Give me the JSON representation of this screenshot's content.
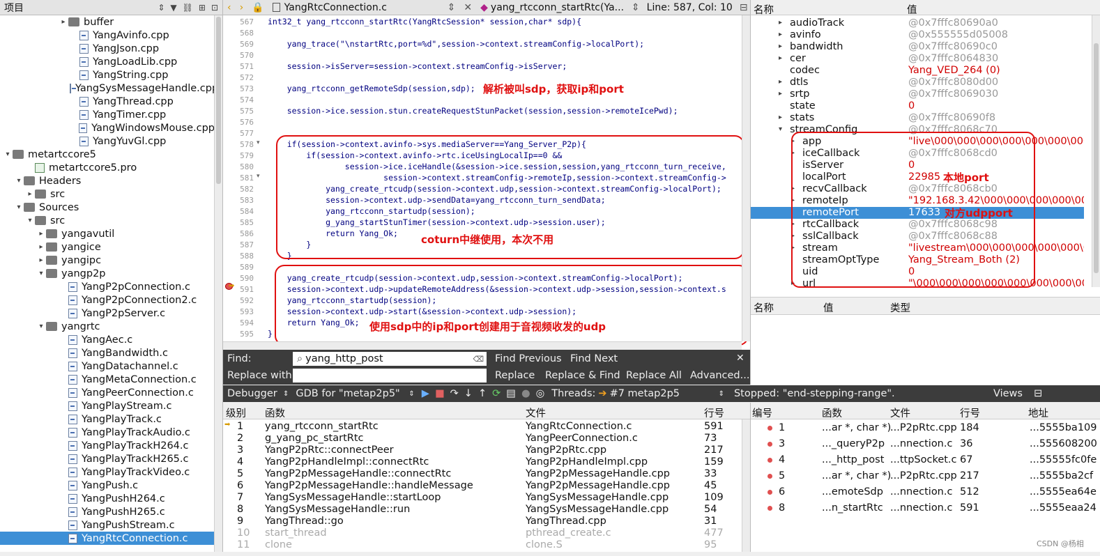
{
  "left": {
    "header": "项目",
    "tree": [
      {
        "label": "buffer",
        "indent": 5,
        "kind": "dir",
        "arrow": "▸"
      },
      {
        "label": "YangAvinfo.cpp",
        "indent": 6,
        "kind": "file"
      },
      {
        "label": "YangJson.cpp",
        "indent": 6,
        "kind": "file"
      },
      {
        "label": "YangLoadLib.cpp",
        "indent": 6,
        "kind": "file"
      },
      {
        "label": "YangString.cpp",
        "indent": 6,
        "kind": "file"
      },
      {
        "label": "YangSysMessageHandle.cpp",
        "indent": 6,
        "kind": "file"
      },
      {
        "label": "YangThread.cpp",
        "indent": 6,
        "kind": "file"
      },
      {
        "label": "YangTimer.cpp",
        "indent": 6,
        "kind": "file"
      },
      {
        "label": "YangWindowsMouse.cpp",
        "indent": 6,
        "kind": "file"
      },
      {
        "label": "YangYuvGl.cpp",
        "indent": 6,
        "kind": "file"
      },
      {
        "label": "metartccore5",
        "indent": 0,
        "kind": "proj",
        "arrow": "▾"
      },
      {
        "label": "metartccore5.pro",
        "indent": 2,
        "kind": "pro"
      },
      {
        "label": "Headers",
        "indent": 1,
        "kind": "dir",
        "arrow": "▾"
      },
      {
        "label": "src",
        "indent": 2,
        "kind": "dir",
        "arrow": "▸"
      },
      {
        "label": "Sources",
        "indent": 1,
        "kind": "dir",
        "arrow": "▾"
      },
      {
        "label": "src",
        "indent": 2,
        "kind": "dir",
        "arrow": "▾"
      },
      {
        "label": "yangavutil",
        "indent": 3,
        "kind": "dir",
        "arrow": "▸"
      },
      {
        "label": "yangice",
        "indent": 3,
        "kind": "dir",
        "arrow": "▸"
      },
      {
        "label": "yangipc",
        "indent": 3,
        "kind": "dir",
        "arrow": "▸"
      },
      {
        "label": "yangp2p",
        "indent": 3,
        "kind": "dir",
        "arrow": "▾"
      },
      {
        "label": "YangP2pConnection.c",
        "indent": 5,
        "kind": "file"
      },
      {
        "label": "YangP2pConnection2.c",
        "indent": 5,
        "kind": "file"
      },
      {
        "label": "YangP2pServer.c",
        "indent": 5,
        "kind": "file"
      },
      {
        "label": "yangrtc",
        "indent": 3,
        "kind": "dir",
        "arrow": "▾"
      },
      {
        "label": "YangAec.c",
        "indent": 5,
        "kind": "file"
      },
      {
        "label": "YangBandwidth.c",
        "indent": 5,
        "kind": "file"
      },
      {
        "label": "YangDatachannel.c",
        "indent": 5,
        "kind": "file"
      },
      {
        "label": "YangMetaConnection.c",
        "indent": 5,
        "kind": "file"
      },
      {
        "label": "YangPeerConnection.c",
        "indent": 5,
        "kind": "file"
      },
      {
        "label": "YangPlayStream.c",
        "indent": 5,
        "kind": "file"
      },
      {
        "label": "YangPlayTrack.c",
        "indent": 5,
        "kind": "file"
      },
      {
        "label": "YangPlayTrackAudio.c",
        "indent": 5,
        "kind": "file"
      },
      {
        "label": "YangPlayTrackH264.c",
        "indent": 5,
        "kind": "file"
      },
      {
        "label": "YangPlayTrackH265.c",
        "indent": 5,
        "kind": "file"
      },
      {
        "label": "YangPlayTrackVideo.c",
        "indent": 5,
        "kind": "file"
      },
      {
        "label": "YangPush.c",
        "indent": 5,
        "kind": "file"
      },
      {
        "label": "YangPushH264.c",
        "indent": 5,
        "kind": "file"
      },
      {
        "label": "YangPushH265.c",
        "indent": 5,
        "kind": "file"
      },
      {
        "label": "YangPushStream.c",
        "indent": 5,
        "kind": "file"
      },
      {
        "label": "YangRtcConnection.c",
        "indent": 5,
        "kind": "file",
        "selected": true
      }
    ]
  },
  "editor": {
    "file_tab": "YangRtcConnection.c",
    "func_tab": "yang_rtcconn_startRtc(Ya...",
    "position": "Line: 587, Col: 10",
    "lines": [
      {
        "n": "567",
        "text": "int32_t yang_rtcconn_startRtc(YangRtcSession* session,char* sdp){"
      },
      {
        "n": "568",
        "text": ""
      },
      {
        "n": "569",
        "text": "    yang_trace(\"\\nstartRtc,port=%d\",session->context.streamConfig->localPort);"
      },
      {
        "n": "570",
        "text": ""
      },
      {
        "n": "571",
        "text": "    session->isServer=session->context.streamConfig->isServer;"
      },
      {
        "n": "572",
        "text": ""
      },
      {
        "n": "573",
        "text": "    yang_rtcconn_getRemoteSdp(session,sdp);"
      },
      {
        "n": "574",
        "text": ""
      },
      {
        "n": "575",
        "text": "    session->ice.session.stun.createRequestStunPacket(session,session->remoteIcePwd);"
      },
      {
        "n": "576",
        "text": ""
      },
      {
        "n": "577",
        "text": ""
      },
      {
        "n": "578",
        "text": "    if(session->context.avinfo->sys.mediaServer==Yang_Server_P2p){"
      },
      {
        "n": "579",
        "text": "        if(session->context.avinfo->rtc.iceUsingLocalIp==0 &&"
      },
      {
        "n": "580",
        "text": "                session->ice.iceHandle(&session->ice.session,session,yang_rtcconn_turn_receive,"
      },
      {
        "n": "581",
        "text": "                        session->context.streamConfig->remoteIp,session->context.streamConfig->"
      },
      {
        "n": "582",
        "text": "            yang_create_rtcudp(session->context.udp,session->context.streamConfig->localPort);"
      },
      {
        "n": "583",
        "text": "            session->context.udp->sendData=yang_rtcconn_turn_sendData;"
      },
      {
        "n": "584",
        "text": "            yang_rtcconn_startudp(session);"
      },
      {
        "n": "585",
        "text": "            g_yang_startStunTimer(session->context.udp->session.user);"
      },
      {
        "n": "586",
        "text": "            return Yang_Ok;"
      },
      {
        "n": "587",
        "text": "        }"
      },
      {
        "n": "588",
        "text": "    }"
      },
      {
        "n": "589",
        "text": ""
      },
      {
        "n": "590",
        "text": "    yang_create_rtcudp(session->context.udp,session->context.streamConfig->localPort);"
      },
      {
        "n": "591",
        "text": "    session->context.udp->updateRemoteAddress(&session->context.udp->session,session->context.s"
      },
      {
        "n": "592",
        "text": "    yang_rtcconn_startudp(session);"
      },
      {
        "n": "593",
        "text": "    session->context.udp->start(&session->context.udp->session);"
      },
      {
        "n": "594",
        "text": "    return Yang_Ok;"
      },
      {
        "n": "595",
        "text": "}"
      }
    ],
    "annotations": {
      "sdp": "解析被叫sdp，获取ip和port",
      "coturn": "coturn中继使用，本次不用",
      "udp": "使用sdp中的ip和port创建用于音视频收发的udp"
    }
  },
  "findbar": {
    "find_label": "Find:",
    "find_value": "yang_http_post",
    "replace_label": "Replace with:",
    "find_prev": "Find Previous",
    "find_next": "Find Next",
    "replace": "Replace",
    "replace_find": "Replace & Find",
    "replace_all": "Replace All",
    "advanced": "Advanced..."
  },
  "debugbar": {
    "debugger": "Debugger",
    "gdb": "GDB for \"metap2p5\"",
    "threads_label": "Threads:",
    "thread": "#7 metap2p5",
    "stopped": "Stopped: \"end-stepping-range\".",
    "views": "Views"
  },
  "stack": {
    "headers": [
      "级别",
      "函数",
      "文件",
      "行号"
    ],
    "rows": [
      {
        "level": "1",
        "func": "yang_rtcconn_startRtc",
        "file": "YangRtcConnection.c",
        "line": "591",
        "current": true
      },
      {
        "level": "2",
        "func": "g_yang_pc_startRtc",
        "file": "YangPeerConnection.c",
        "line": "73"
      },
      {
        "level": "3",
        "func": "YangP2pRtc::connectPeer",
        "file": "YangP2pRtc.cpp",
        "line": "217"
      },
      {
        "level": "4",
        "func": "YangP2pHandleImpl::connectRtc",
        "file": "YangP2pHandleImpl.cpp",
        "line": "159"
      },
      {
        "level": "5",
        "func": "YangP2pMessageHandle::connectRtc",
        "file": "YangP2pMessageHandle.cpp",
        "line": "33"
      },
      {
        "level": "6",
        "func": "YangP2pMessageHandle::handleMessage",
        "file": "YangP2pMessageHandle.cpp",
        "line": "45"
      },
      {
        "level": "7",
        "func": "YangSysMessageHandle::startLoop",
        "file": "YangSysMessageHandle.cpp",
        "line": "109"
      },
      {
        "level": "8",
        "func": "YangSysMessageHandle::run",
        "file": "YangSysMessageHandle.cpp",
        "line": "54"
      },
      {
        "level": "9",
        "func": "YangThread::go",
        "file": "YangThread.cpp",
        "line": "31"
      },
      {
        "level": "10",
        "func": "start_thread",
        "file": "pthread_create.c",
        "line": "477",
        "dim": true
      },
      {
        "level": "11",
        "func": "clone",
        "file": "clone.S",
        "line": "95",
        "dim": true
      }
    ]
  },
  "locals": {
    "headers": [
      "名称",
      "值"
    ],
    "rows": [
      {
        "name": "audioTrack",
        "value": "@0x7fffc80690a0",
        "indent": 0,
        "arrow": "▸",
        "vc": "gray"
      },
      {
        "name": "avinfo",
        "value": "@0x555555d05008",
        "indent": 0,
        "arrow": "▸",
        "vc": "gray"
      },
      {
        "name": "bandwidth",
        "value": "@0x7fffc80690c0",
        "indent": 0,
        "arrow": "▸",
        "vc": "gray"
      },
      {
        "name": "cer",
        "value": "@0x7fffc8064830",
        "indent": 0,
        "arrow": "▸",
        "vc": "gray"
      },
      {
        "name": "codec",
        "value": "Yang_VED_264 (0)",
        "indent": 0,
        "arrow": "",
        "vc": "red"
      },
      {
        "name": "dtls",
        "value": "@0x7fffc8080d00",
        "indent": 0,
        "arrow": "▸",
        "vc": "gray"
      },
      {
        "name": "srtp",
        "value": "@0x7fffc8069030",
        "indent": 0,
        "arrow": "▸",
        "vc": "gray"
      },
      {
        "name": "state",
        "value": "0",
        "indent": 0,
        "arrow": "",
        "vc": "red"
      },
      {
        "name": "stats",
        "value": "@0x7fffc80690f8",
        "indent": 0,
        "arrow": "▸",
        "vc": "gray"
      },
      {
        "name": "streamConfig",
        "value": "@0x7fffc8068c70",
        "indent": 0,
        "arrow": "▾",
        "vc": "gray"
      },
      {
        "name": "app",
        "value": "\"live\\000\\000\\000\\000\\000\\000\\000\\",
        "indent": 1,
        "arrow": "▸",
        "vc": "red"
      },
      {
        "name": "iceCallback",
        "value": "@0x7fffc8068cd0",
        "indent": 1,
        "arrow": "▸",
        "vc": "gray"
      },
      {
        "name": "isServer",
        "value": "0",
        "indent": 1,
        "arrow": "",
        "vc": "red"
      },
      {
        "name": "localPort",
        "value": "22985",
        "indent": 1,
        "arrow": "",
        "vc": "red",
        "note": "本地port"
      },
      {
        "name": "recvCallback",
        "value": "@0x7fffc8068cb0",
        "indent": 1,
        "arrow": "▸",
        "vc": "gray"
      },
      {
        "name": "remoteIp",
        "value": "\"192.168.3.42\\000\\000\\000\\000\\000\\000\\",
        "indent": 1,
        "arrow": "▸",
        "vc": "red"
      },
      {
        "name": "remotePort",
        "value": "17633",
        "indent": 1,
        "arrow": "",
        "vc": "red",
        "note": "对方udpport",
        "selected": true
      },
      {
        "name": "rtcCallback",
        "value": "@0x7fffc8068c98",
        "indent": 1,
        "arrow": "▸",
        "vc": "gray"
      },
      {
        "name": "sslCallback",
        "value": "@0x7fffc8068c88",
        "indent": 1,
        "arrow": "▸",
        "vc": "gray"
      },
      {
        "name": "stream",
        "value": "\"livestream\\000\\000\\000\\000\\000\\000\\",
        "indent": 1,
        "arrow": "▸",
        "vc": "red"
      },
      {
        "name": "streamOptType",
        "value": "Yang_Stream_Both (2)",
        "indent": 1,
        "arrow": "",
        "vc": "red"
      },
      {
        "name": "uid",
        "value": "0",
        "indent": 1,
        "arrow": "",
        "vc": "red"
      },
      {
        "name": "url",
        "value": "\"\\000\\000\\000\\000\\000\\000\\000\\000\\000\\",
        "indent": 1,
        "arrow": "▸",
        "vc": "red"
      }
    ]
  },
  "watch": {
    "headers": [
      "名称",
      "值",
      "类型"
    ]
  },
  "breakpoints": {
    "headers": [
      "编号",
      "函数",
      "文件",
      "行号",
      "地址"
    ],
    "rows": [
      {
        "num": "1",
        "func": "...ar *, char *)",
        "file": "...P2pRtc.cpp",
        "line": "184",
        "addr": "...5555ba109"
      },
      {
        "num": "3",
        "func": "..._queryP2p",
        "file": "...nnection.c",
        "line": "36",
        "addr": "...555608200"
      },
      {
        "num": "4",
        "func": "..._http_post",
        "file": "...ttpSocket.c",
        "line": "67",
        "addr": "...55555fc0fe"
      },
      {
        "num": "5",
        "func": "...ar *, char *)",
        "file": "...P2pRtc.cpp",
        "line": "217",
        "addr": "...5555ba2cf"
      },
      {
        "num": "6",
        "func": "...emoteSdp",
        "file": "...nnection.c",
        "line": "512",
        "addr": "...5555ea64e"
      },
      {
        "num": "8",
        "func": "...n_startRtc",
        "file": "...nnection.c",
        "line": "591",
        "addr": "...5555eaa24"
      }
    ]
  },
  "watermark": "CSDN @杨相"
}
